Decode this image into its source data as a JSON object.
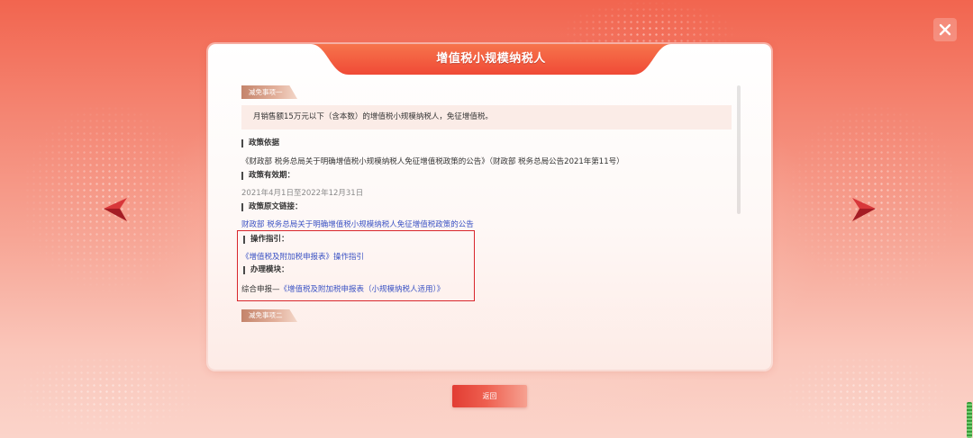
{
  "window": {
    "close_icon": "close-icon"
  },
  "nav": {
    "prev_icon": "arrow-left-icon",
    "next_icon": "arrow-right-icon"
  },
  "dialog": {
    "title": "增值税小规模纳税人",
    "item1": {
      "tag": "减免事项一",
      "summary": "月销售额15万元以下（含本数）的增值税小规模纳税人，免征增值税。",
      "policy_basis_heading": "政策依据",
      "policy_basis_text": "《财政部 税务总局关于明确增值税小规模纳税人免征增值税政策的公告》（财政部 税务总局公告2021年第11号）",
      "validity_heading": "政策有效期：",
      "validity_text": "2021年4月1日至2022年12月31日",
      "link_heading": "政策原文链接：",
      "link_text": "财政部 税务总局关于明确增值税小规模纳税人免征增值税政策的公告",
      "guide_heading": "操作指引：",
      "guide_link": "《增值税及附加税申报表》操作指引",
      "module_heading": "办理模块：",
      "module_prefix": "综合申报—",
      "module_link": "《增值税及附加税申报表（小规模纳税人适用）》"
    },
    "item2": {
      "tag": "减免事项二"
    }
  },
  "footer": {
    "back_label": "返回"
  },
  "colors": {
    "accent": "#f04e38",
    "link": "#3a52c4",
    "highlight_border": "#d8262c",
    "tag": "#c4846b"
  }
}
